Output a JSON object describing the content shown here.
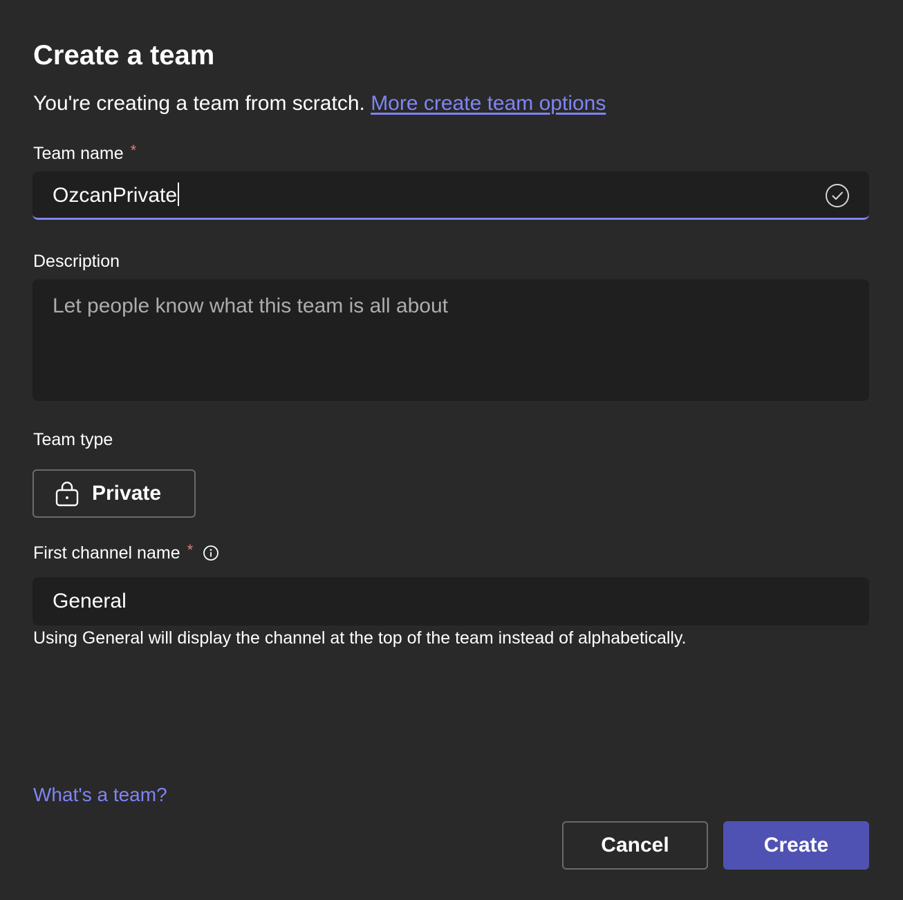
{
  "dialog": {
    "title": "Create a team",
    "subtitle": "You're creating a team from scratch.",
    "subtitle_link": "More create team options"
  },
  "fields": {
    "team_name": {
      "label": "Team name",
      "required_mark": "*",
      "value": "OzcanPrivate",
      "status_icon": "checkmark-circle-icon"
    },
    "description": {
      "label": "Description",
      "value": "",
      "placeholder": "Let people know what this team is all about"
    },
    "team_type": {
      "label": "Team type",
      "selected": "Private",
      "icon": "lock-icon"
    },
    "first_channel": {
      "label": "First channel name",
      "required_mark": "*",
      "info_icon": "info-icon",
      "value": "General",
      "hint": "Using General will display the channel at the top of the team instead of alphabetically."
    }
  },
  "footer": {
    "help_link": "What's a team?",
    "cancel_label": "Cancel",
    "create_label": "Create"
  },
  "colors": {
    "background": "#292929",
    "input_background": "#1f1f1f",
    "accent": "#7f85f5",
    "primary_button": "#4f52b2",
    "required": "#e37d80"
  }
}
